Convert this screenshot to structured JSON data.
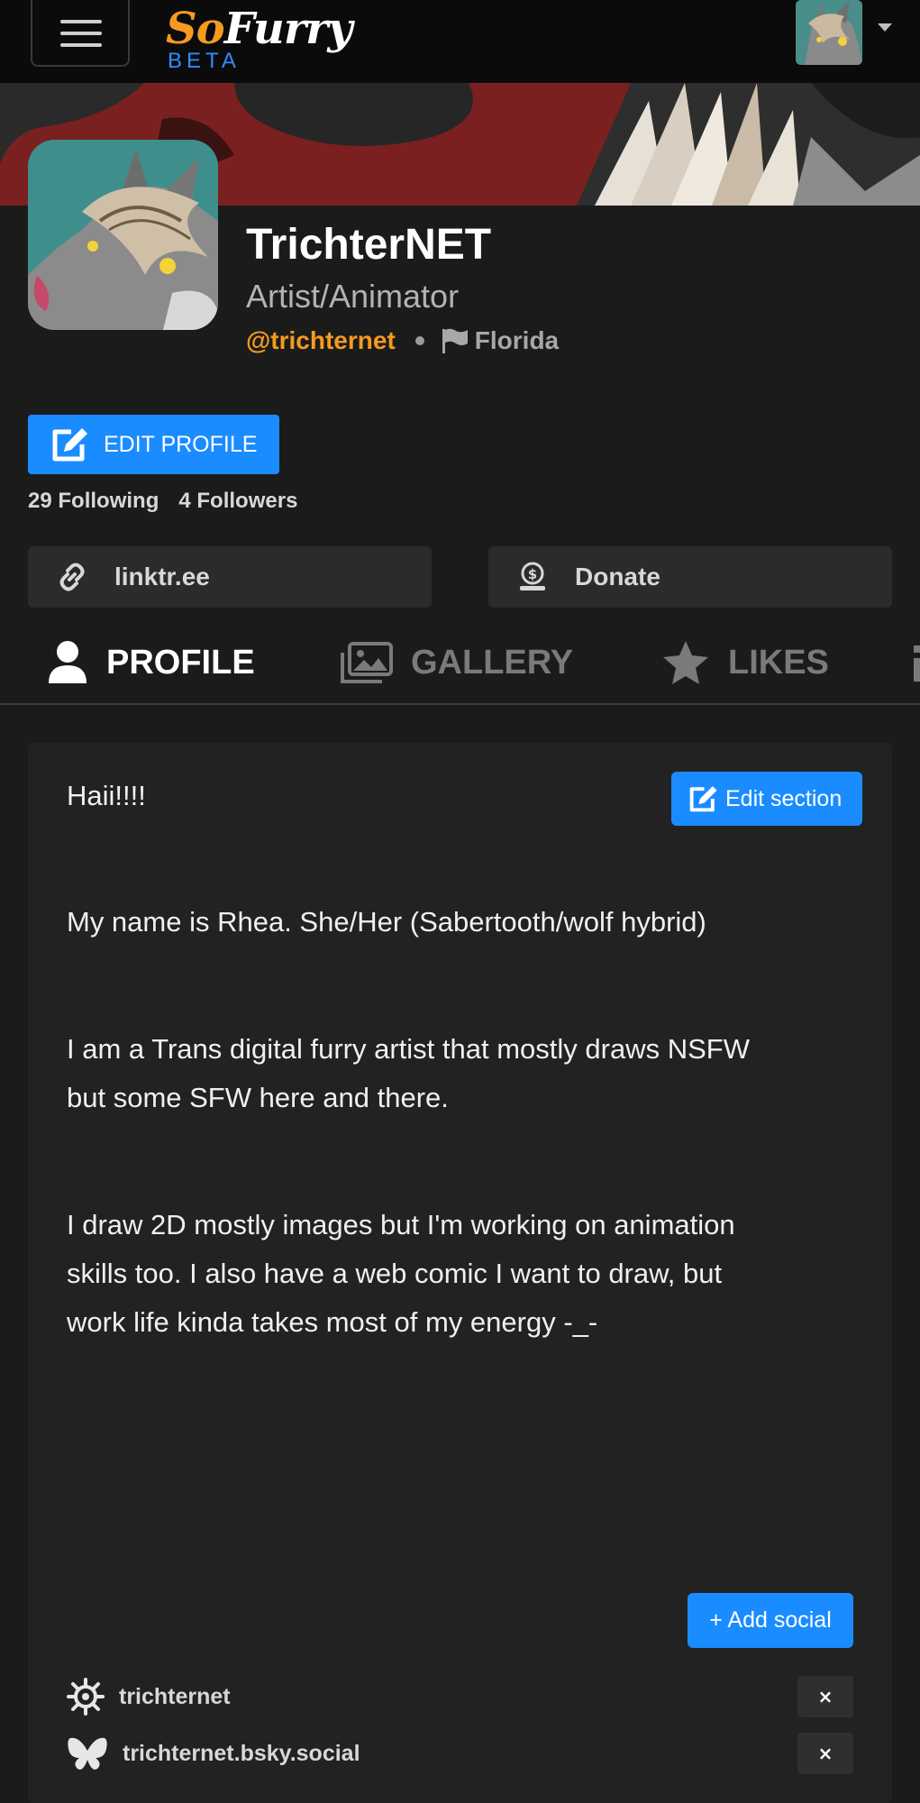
{
  "header": {
    "logo_brand": "SoFurry",
    "logo_so": "So",
    "logo_furry": "Furry",
    "logo_beta": "BETA"
  },
  "profile": {
    "display_name": "TrichterNET",
    "title": "Artist/Animator",
    "handle": "@trichternet",
    "location": "Florida",
    "edit_profile_label": "EDIT PROFILE",
    "following_count": "29",
    "following_label": "Following",
    "followers_count": "4",
    "followers_label": "Followers"
  },
  "links": [
    {
      "icon": "link-icon",
      "label": "linktr.ee"
    },
    {
      "icon": "donate-icon",
      "label": "Donate"
    }
  ],
  "tabs": [
    {
      "icon": "user-icon",
      "label": "PROFILE",
      "active": true
    },
    {
      "icon": "images-icon",
      "label": "GALLERY",
      "active": false
    },
    {
      "icon": "star-icon",
      "label": "LIKES",
      "active": false
    }
  ],
  "about": {
    "edit_section_label": "Edit section",
    "paragraphs": [
      "Haii!!!!",
      "My name is Rhea. She/Her (Sabertooth/wolf hybrid)",
      "I am a Trans digital furry artist that mostly draws NSFW",
      "but some SFW here and there.",
      "I draw 2D mostly images but I'm working on animation",
      "skills too. I also have a web comic I want to draw, but",
      "work life kinda takes most of my energy -_-"
    ]
  },
  "socials": {
    "add_label": "+ Add social",
    "items": [
      {
        "icon": "misskey-icon",
        "label": "trichternet",
        "remove": "×"
      },
      {
        "icon": "bluesky-butterfly-icon",
        "label": "trichternet.bsky.social",
        "remove": "×"
      }
    ]
  },
  "colors": {
    "accent_blue": "#1a8cff",
    "handle_orange": "#f59a1f",
    "background": "#1b1b1b",
    "card": "#222222"
  }
}
